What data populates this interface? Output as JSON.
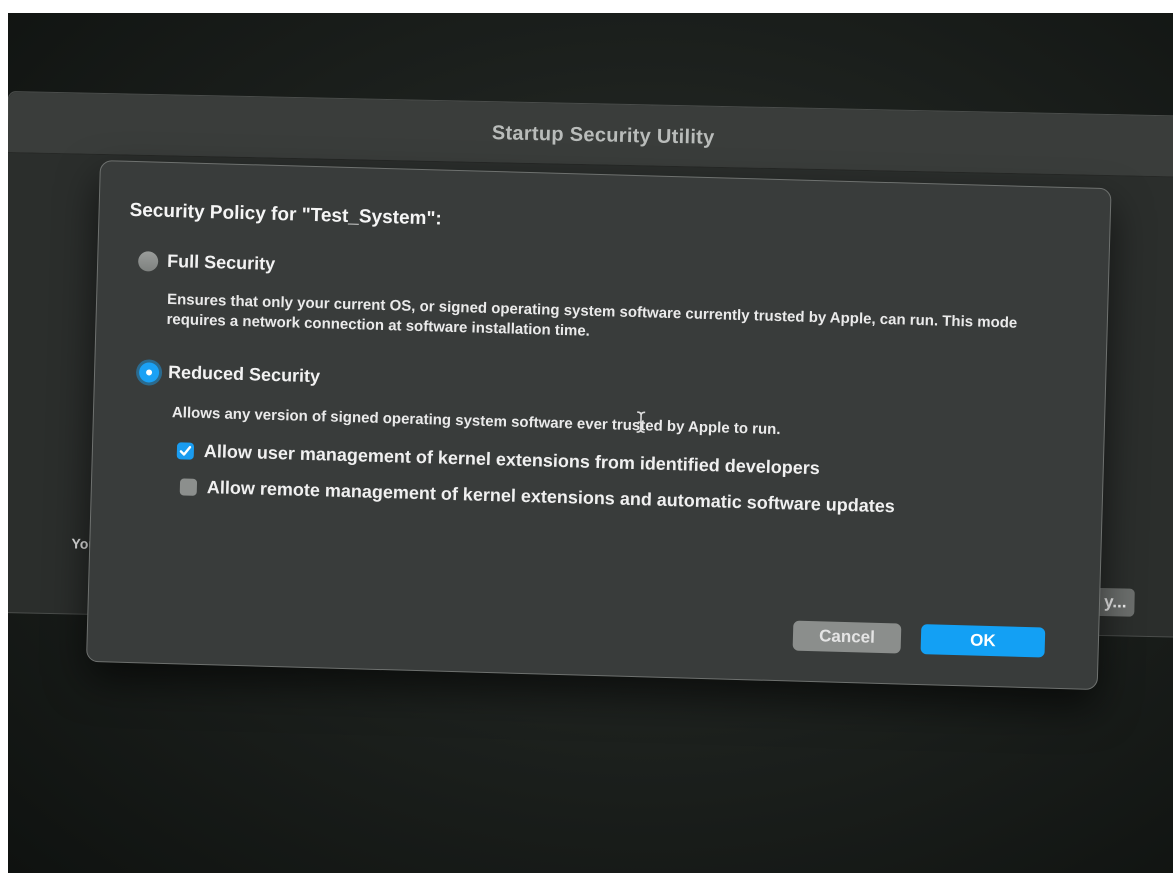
{
  "window": {
    "title": "Startup Security Utility",
    "partial_left_text": "You h",
    "partial_button_label": "y..."
  },
  "sheet": {
    "heading": "Security Policy for \"Test_System\":",
    "options": [
      {
        "label": "Full Security",
        "selected": false,
        "description": "Ensures that only your current OS, or signed operating system software currently trusted by Apple, can run. This mode requires a network connection at software installation time."
      },
      {
        "label": "Reduced Security",
        "selected": true,
        "description": "Allows any version of signed operating system software ever trusted by Apple to run."
      }
    ],
    "checkboxes": [
      {
        "label": "Allow user management of kernel extensions from identified developers",
        "checked": true
      },
      {
        "label": "Allow remote management of kernel extensions and automatic software updates",
        "checked": false
      }
    ],
    "buttons": {
      "cancel": "Cancel",
      "ok": "OK"
    }
  },
  "colors": {
    "accent": "#13a0f4",
    "sheet_background": "#393c3b"
  },
  "icons": {
    "cursor": "text-cursor-icon",
    "checkmark": "checkmark-icon"
  }
}
